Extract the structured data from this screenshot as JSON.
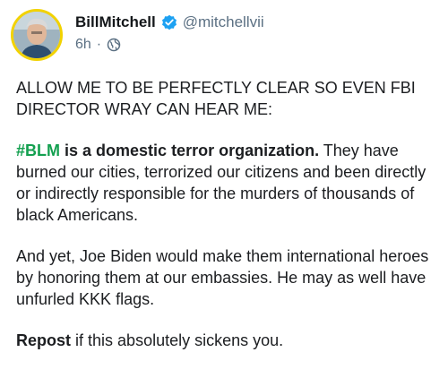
{
  "author": {
    "display_name": "BillMitchell",
    "handle": "@mitchellvii",
    "timestamp": "6h",
    "separator": "·",
    "verified_color": "#1da1f2"
  },
  "post": {
    "p1": "ALLOW ME TO BE PERFECTLY CLEAR SO EVEN FBI DIRECTOR WRAY CAN HEAR ME:",
    "p2_hashtag": "#BLM",
    "p2_bold": "is a domestic terror organization.",
    "p2_rest": "They have burned our cities, terrorized our citizens and been directly or indirectly responsible for the murders of thousands of black Americans.",
    "p3": "And yet, Joe Biden would make them international heroes by honoring them at our embassies. He may as well have unfurled KKK flags.",
    "p4_bold": "Repost",
    "p4_rest": "if this absolutely sickens you."
  },
  "colors": {
    "hashtag": "#14a050",
    "avatar_ring": "#f2d200",
    "muted_text": "#5b7083"
  },
  "icons": {
    "verified": "verified-badge-icon",
    "visibility": "globe-icon"
  }
}
